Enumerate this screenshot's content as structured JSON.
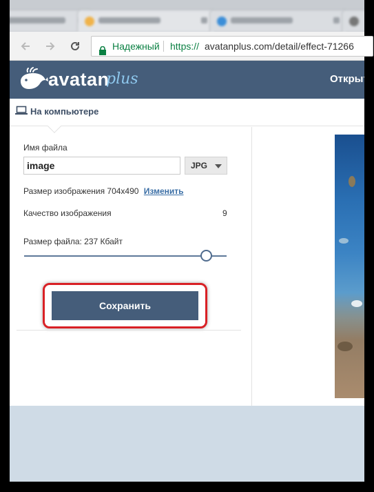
{
  "browser": {
    "security_label": "Надежный",
    "url_protocol": "https://",
    "url_rest": "avatanplus.com/detail/effect-71266",
    "icons": [
      "back-arrow-icon",
      "forward-arrow-icon",
      "reload-icon",
      "lock-icon"
    ]
  },
  "header": {
    "brand_main": "avatan",
    "brand_plus": "plus",
    "open_label": "Открыть",
    "logo_icon": "whale-logo-icon"
  },
  "tabs": {
    "computer_label": "На компьютере",
    "computer_icon": "laptop-icon"
  },
  "form": {
    "filename_label": "Имя файла",
    "filename_value": "image",
    "format_value": "JPG",
    "image_size_label": "Размер изображения 704x490",
    "change_link": "Изменить",
    "quality_label": "Качество изображения",
    "quality_value": "9",
    "quality_level_fraction": 0.9,
    "file_size_label": "Размер файла: 237 Кбайт",
    "save_label": "Сохранить"
  },
  "colors": {
    "brand": "#455d7a",
    "secure_green": "#0b8043",
    "highlight_red": "#d92025",
    "footer_bg": "#cfdbe6"
  }
}
